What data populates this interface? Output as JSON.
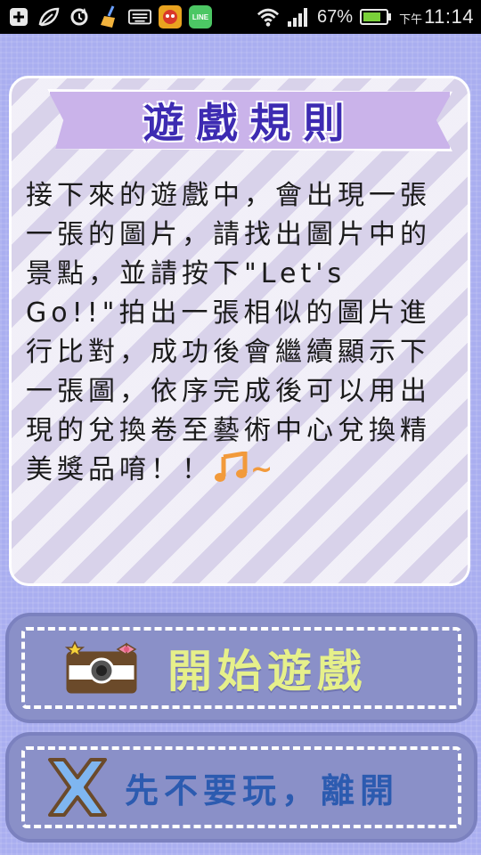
{
  "status_bar": {
    "battery_percent": "67%",
    "ampm": "下午",
    "time": "11:14",
    "line_label": "LINE"
  },
  "rules": {
    "title": "遊戲規則",
    "body": "接下來的遊戲中，會出現一張一張的圖片，請找出圖片中的景點，並請按下\"Let's Go!!\"拍出一張相似的圖片進行比對，成功後會繼續顯示下一張圖，依序完成後可以用出現的兌換卷至藝術中心兌換精美獎品唷！！",
    "tilde": "~"
  },
  "buttons": {
    "start_label": "開始遊戲",
    "leave_label": "先不要玩，離開"
  },
  "colors": {
    "background": "#a9aef0",
    "title_text": "#3d2bb2",
    "start_text": "#e6f08a",
    "leave_text": "#2c5bb0",
    "x_icon": "#7fb6f0"
  },
  "icons": [
    "add-icon",
    "leaf-icon",
    "sync-icon",
    "broom-icon",
    "keyboard-icon",
    "game-app-icon",
    "line-app-icon",
    "wifi-icon",
    "signal-icon",
    "battery-icon",
    "music-note-icon",
    "camera-icon",
    "close-x-icon"
  ]
}
